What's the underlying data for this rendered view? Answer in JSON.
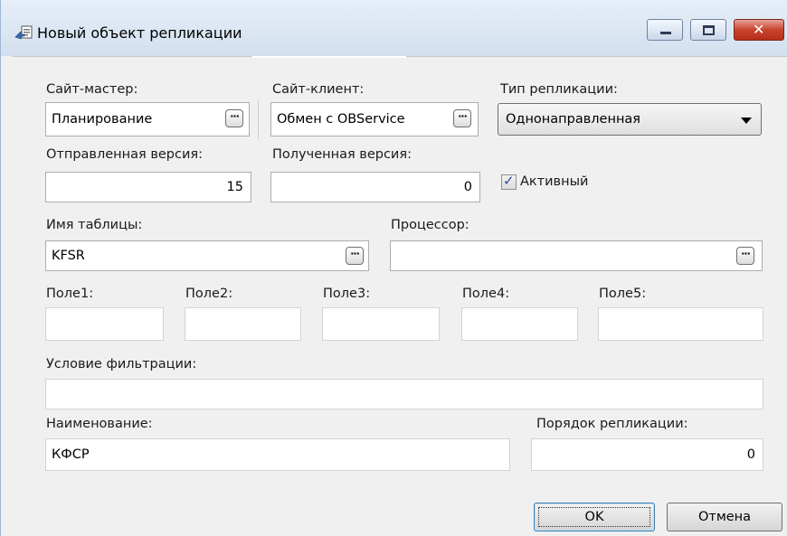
{
  "window": {
    "title": "Новый объект репликации",
    "close_glyph": "✕"
  },
  "labels": {
    "site_master": "Сайт-мастер:",
    "site_client": "Сайт-клиент:",
    "replication_type": "Тип репликации:",
    "sent_version": "Отправленная версия:",
    "received_version": "Полученная версия:",
    "active": "Активный",
    "table_name": "Имя таблицы:",
    "processor": "Процессор:",
    "field1": "Поле1:",
    "field2": "Поле2:",
    "field3": "Поле3:",
    "field4": "Поле4:",
    "field5": "Поле5:",
    "filter_condition": "Условие фильтрации:",
    "name": "Наименование:",
    "replication_order": "Порядок репликации:"
  },
  "values": {
    "site_master": "Планирование",
    "site_client": "Обмен с OBService",
    "replication_type": "Однонаправленная",
    "sent_version": "15",
    "received_version": "0",
    "active_checked": true,
    "table_name": "KFSR",
    "processor": "",
    "field1": "",
    "field2": "",
    "field3": "",
    "field4": "",
    "field5": "",
    "filter_condition": "",
    "name": "КФСР",
    "replication_order": "0"
  },
  "buttons": {
    "ellipsis": "···",
    "ok": "OK",
    "cancel": "Отмена"
  },
  "icons": {
    "title": "replication-object-icon",
    "check": "✓"
  },
  "colors": {
    "titlebar": "#d3e0ef",
    "close_button": "#c7442e",
    "dialog_bg": "#f0f0f0"
  }
}
